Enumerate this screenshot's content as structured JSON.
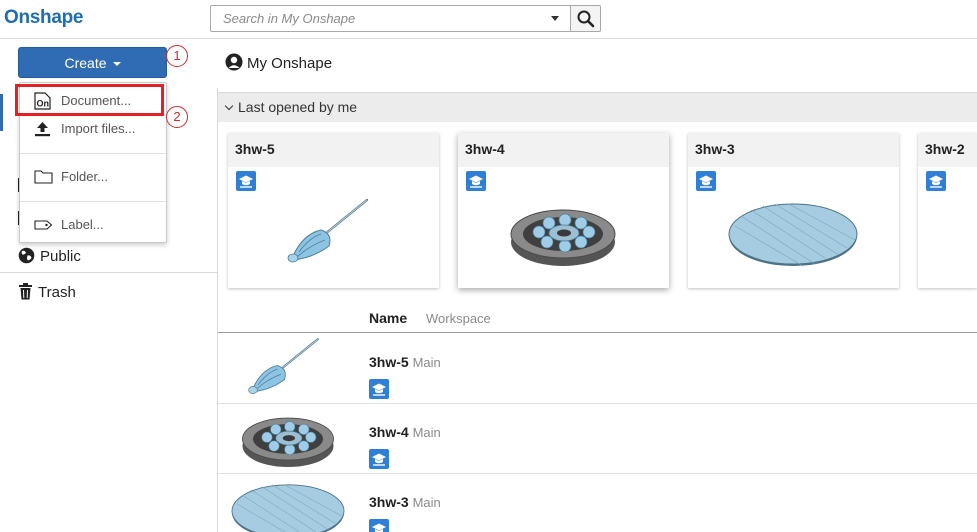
{
  "header": {
    "logo": "Onshape",
    "search_placeholder": "Search in My Onshape"
  },
  "toolbar": {
    "create_label": "Create",
    "breadcrumb": "My Onshape",
    "callout_1": "1",
    "callout_2": "2"
  },
  "create_menu": {
    "items": [
      {
        "label": "Document...",
        "icon": "onshape-document-icon"
      },
      {
        "label": "Import files...",
        "icon": "upload-icon"
      },
      {
        "label": "Folder...",
        "icon": "folder-icon"
      },
      {
        "label": "Label...",
        "icon": "tag-icon"
      }
    ]
  },
  "sidebar": {
    "items": [
      {
        "label": "Public",
        "icon": "globe-icon"
      },
      {
        "label": "Trash",
        "icon": "trash-icon"
      }
    ]
  },
  "recent": {
    "heading": "Last opened by me",
    "cards": [
      {
        "title": "3hw-5",
        "thumb": "screwdriver"
      },
      {
        "title": "3hw-4",
        "thumb": "bearing"
      },
      {
        "title": "3hw-3",
        "thumb": "disc"
      },
      {
        "title": "3hw-2",
        "thumb": "none"
      }
    ]
  },
  "list": {
    "col_name": "Name",
    "col_workspace": "Workspace",
    "rows": [
      {
        "name": "3hw-5",
        "workspace": "Main"
      },
      {
        "name": "3hw-4",
        "workspace": "Main"
      },
      {
        "name": "3hw-3",
        "workspace": "Main"
      }
    ]
  },
  "colors": {
    "brand": "#1f6cb0",
    "create_button": "#2f6cb4",
    "highlight": "#e2202a",
    "badge": "#2f7fd6"
  }
}
